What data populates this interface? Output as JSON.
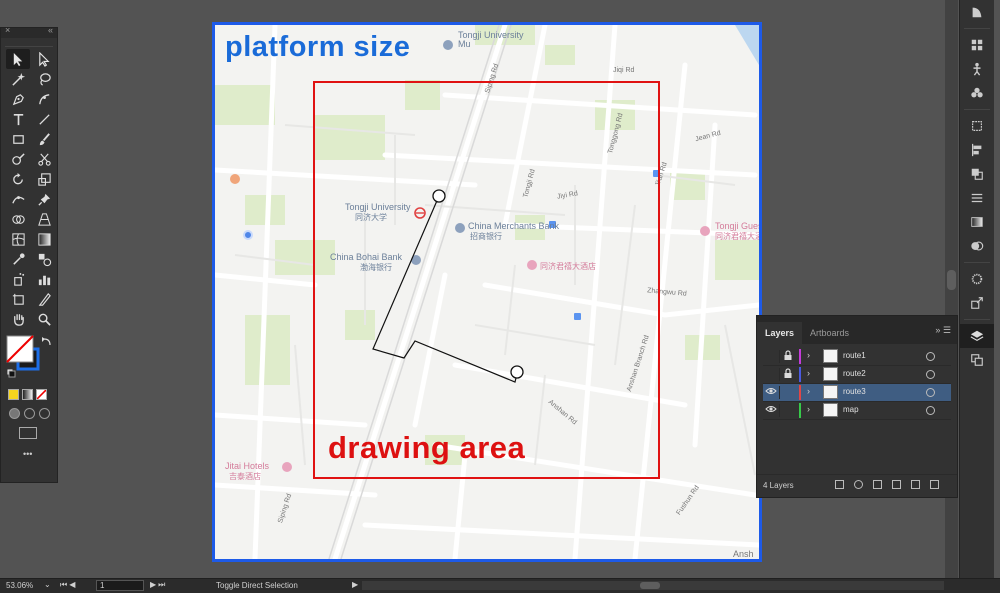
{
  "canvas": {
    "platform_label": "platform size",
    "drawing_label": "drawing area",
    "colors": {
      "artboard_border": "#1d5ae8",
      "drawing_area_border": "#e01212",
      "platform_label": "#1a6bd8"
    }
  },
  "map": {
    "pois": [
      {
        "en": "Tongji University",
        "cn": "同济大学"
      },
      {
        "en": "China Merchants Bank",
        "cn": "招商银行"
      },
      {
        "en": "China Bohai Bank",
        "cn": "渤海银行"
      },
      {
        "en": "Tongji Guest House",
        "cn": "同济君禧大酒店"
      },
      {
        "en": "Jitai Hotels",
        "cn": "吉泰酒店"
      },
      {
        "cn": "同济君禧大酒店"
      }
    ],
    "top_poi": {
      "en": "Tongji University",
      "en2": "Mu"
    },
    "roads": [
      "Siping Rd",
      "Jiyi Rd",
      "Jiqi Rd",
      "Jean Rd",
      "Zhangwu Rd",
      "Anshan Rd",
      "Anshan Branch Rd",
      "Fushun Rd",
      "Tonggong Rd",
      "Tongji Rd",
      "Siping Rd",
      "Ji'an Rd",
      "Ansh"
    ]
  },
  "tools_panel": {
    "header_close": "×",
    "header_collapse": "«",
    "more": "•••"
  },
  "layers_panel": {
    "tabs": [
      "Layers",
      "Artboards"
    ],
    "menu_icons": "»  ☰",
    "layers": [
      {
        "name": "route1",
        "visible": false,
        "locked": true,
        "color": "#c43bd9",
        "selected": false
      },
      {
        "name": "route2",
        "visible": false,
        "locked": true,
        "color": "#4b5ae0",
        "selected": false
      },
      {
        "name": "route3",
        "visible": true,
        "locked": false,
        "color": "#e04646",
        "selected": true
      },
      {
        "name": "map",
        "visible": true,
        "locked": false,
        "color": "#37c94a",
        "selected": false
      }
    ],
    "count_label": "4 Layers"
  },
  "status_bar": {
    "zoom": "53.06%",
    "page": "1",
    "status_text": "Toggle Direct Selection"
  }
}
